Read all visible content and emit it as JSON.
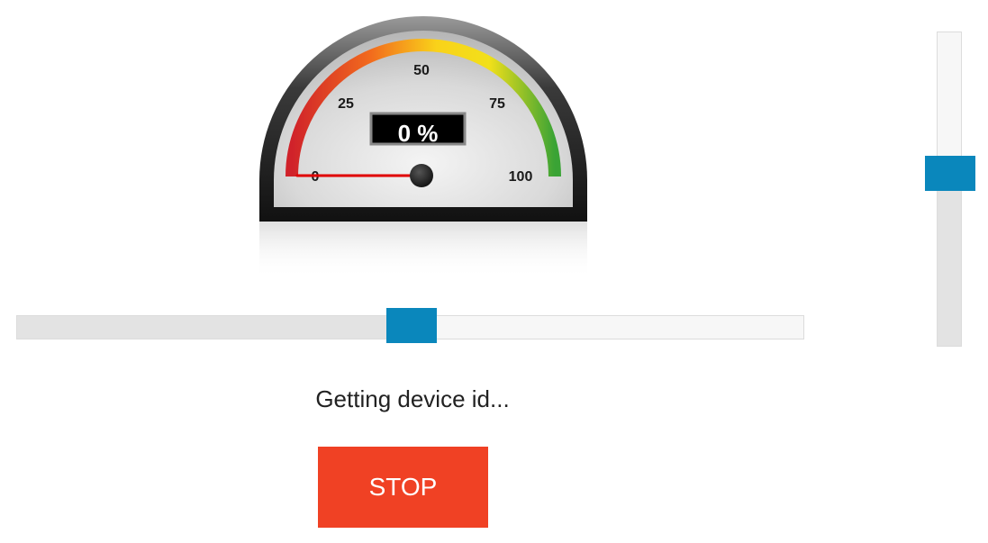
{
  "gauge": {
    "readout": "0 %",
    "value": 0,
    "min": 0,
    "max": 100,
    "tick_labels": [
      "0",
      "25",
      "50",
      "75",
      "100"
    ]
  },
  "horizontal_slider": {
    "value": 0.5
  },
  "vertical_slider": {
    "value": 0.56
  },
  "status": {
    "text": "Getting device id..."
  },
  "controls": {
    "stop_label": "STOP"
  },
  "colors": {
    "slider_thumb": "#0a87bc",
    "stop_button": "#f04124",
    "needle": "#e00000"
  }
}
